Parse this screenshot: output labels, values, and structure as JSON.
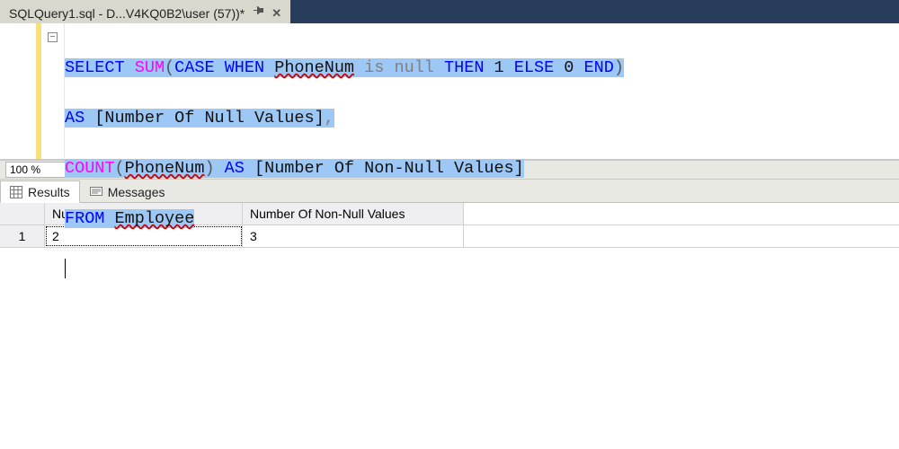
{
  "tab": {
    "title": "SQLQuery1.sql - D...V4KQ0B2\\user (57))*"
  },
  "editor": {
    "outline_symbol": "−",
    "code": {
      "l1": {
        "a": "SELECT",
        "b": "SUM",
        "c": "CASE",
        "d": "WHEN",
        "e": "PhoneNum",
        "f": "is",
        "g": "null",
        "h": "THEN",
        "i": "1",
        "j": "ELSE",
        "k": "0",
        "l": "END"
      },
      "l2": {
        "a": "AS",
        "b": "[Number Of Null Values]"
      },
      "l3": {
        "a": "COUNT",
        "b": "PhoneNum",
        "c": "AS",
        "d": "[Number Of Non-Null Values]"
      },
      "l4": {
        "a": "FROM",
        "b": "Employee"
      }
    }
  },
  "zoom": {
    "value": "100 %"
  },
  "result_tabs": {
    "results": "Results",
    "messages": "Messages"
  },
  "grid": {
    "columns": [
      "Number Of Null Values",
      "Number Of Non-Null Values"
    ],
    "rows": [
      {
        "num": "1",
        "cells": [
          "2",
          "3"
        ]
      }
    ]
  }
}
